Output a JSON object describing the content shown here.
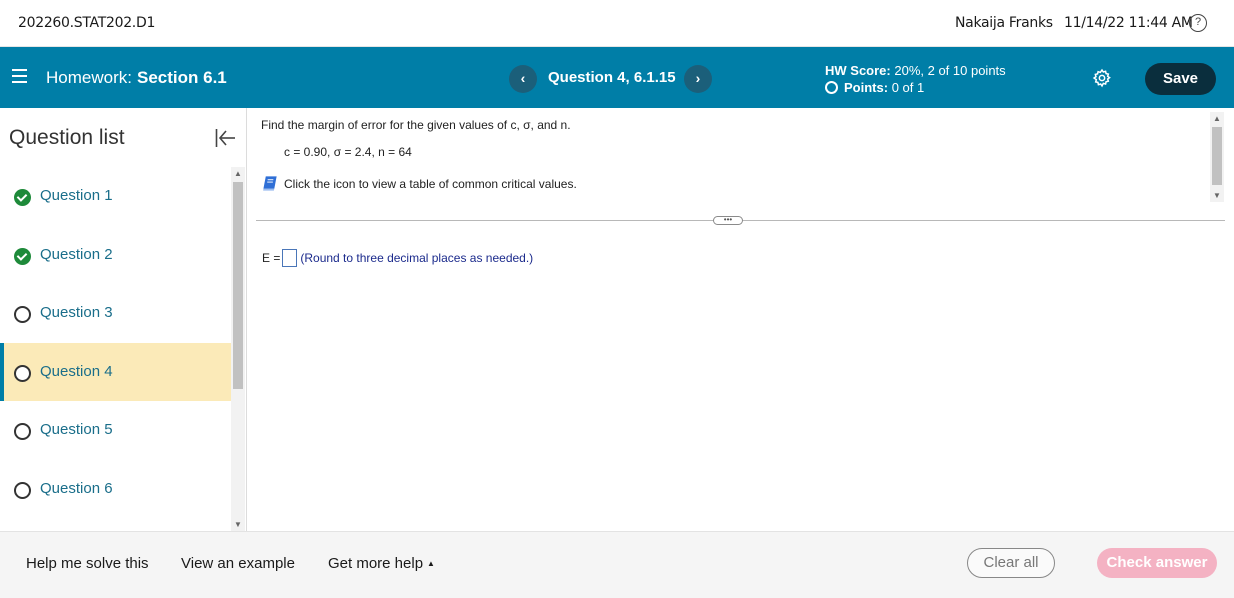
{
  "topbar": {
    "course": "202260.STAT202.D1",
    "user": "Nakaija Franks",
    "datetime": "11/14/22 11:44 AM",
    "help_icon": "?"
  },
  "header": {
    "homework_label": "Homework:",
    "section": "Section 6.1",
    "question_title": "Question 4, 6.1.15",
    "prev_icon": "‹",
    "next_icon": "›",
    "score_label": "HW Score:",
    "score_value": "20%, 2 of 10 points",
    "points_label": "Points:",
    "points_value": "0 of 1",
    "save_label": "Save"
  },
  "sidebar": {
    "title": "Question list",
    "items": [
      {
        "label": "Question 1",
        "status": "done"
      },
      {
        "label": "Question 2",
        "status": "done"
      },
      {
        "label": "Question 3",
        "status": "open"
      },
      {
        "label": "Question 4",
        "status": "open",
        "active": true
      },
      {
        "label": "Question 5",
        "status": "open"
      },
      {
        "label": "Question 6",
        "status": "open"
      }
    ]
  },
  "content": {
    "question": "Find the margin of error for the given values of c, σ, and n.",
    "params": "c = 0.90, σ = 2.4, n = 64",
    "table_link": "Click the icon to view a table of common critical values.",
    "answer_label": "E =",
    "answer_hint": "(Round to three decimal places as needed.)",
    "divider_handle": "•••"
  },
  "footer": {
    "help_solve": "Help me solve this",
    "view_example": "View an example",
    "more_help": "Get more help",
    "more_caret": "▲",
    "clear_all": "Clear all",
    "check_answer": "Check answer"
  },
  "colors": {
    "header_bg": "#007ea7",
    "save_bg": "#0a2e3d",
    "active_item_bg": "#fbeab8",
    "done_green": "#1e8a3a",
    "check_answer_bg": "#f4b2c3"
  }
}
